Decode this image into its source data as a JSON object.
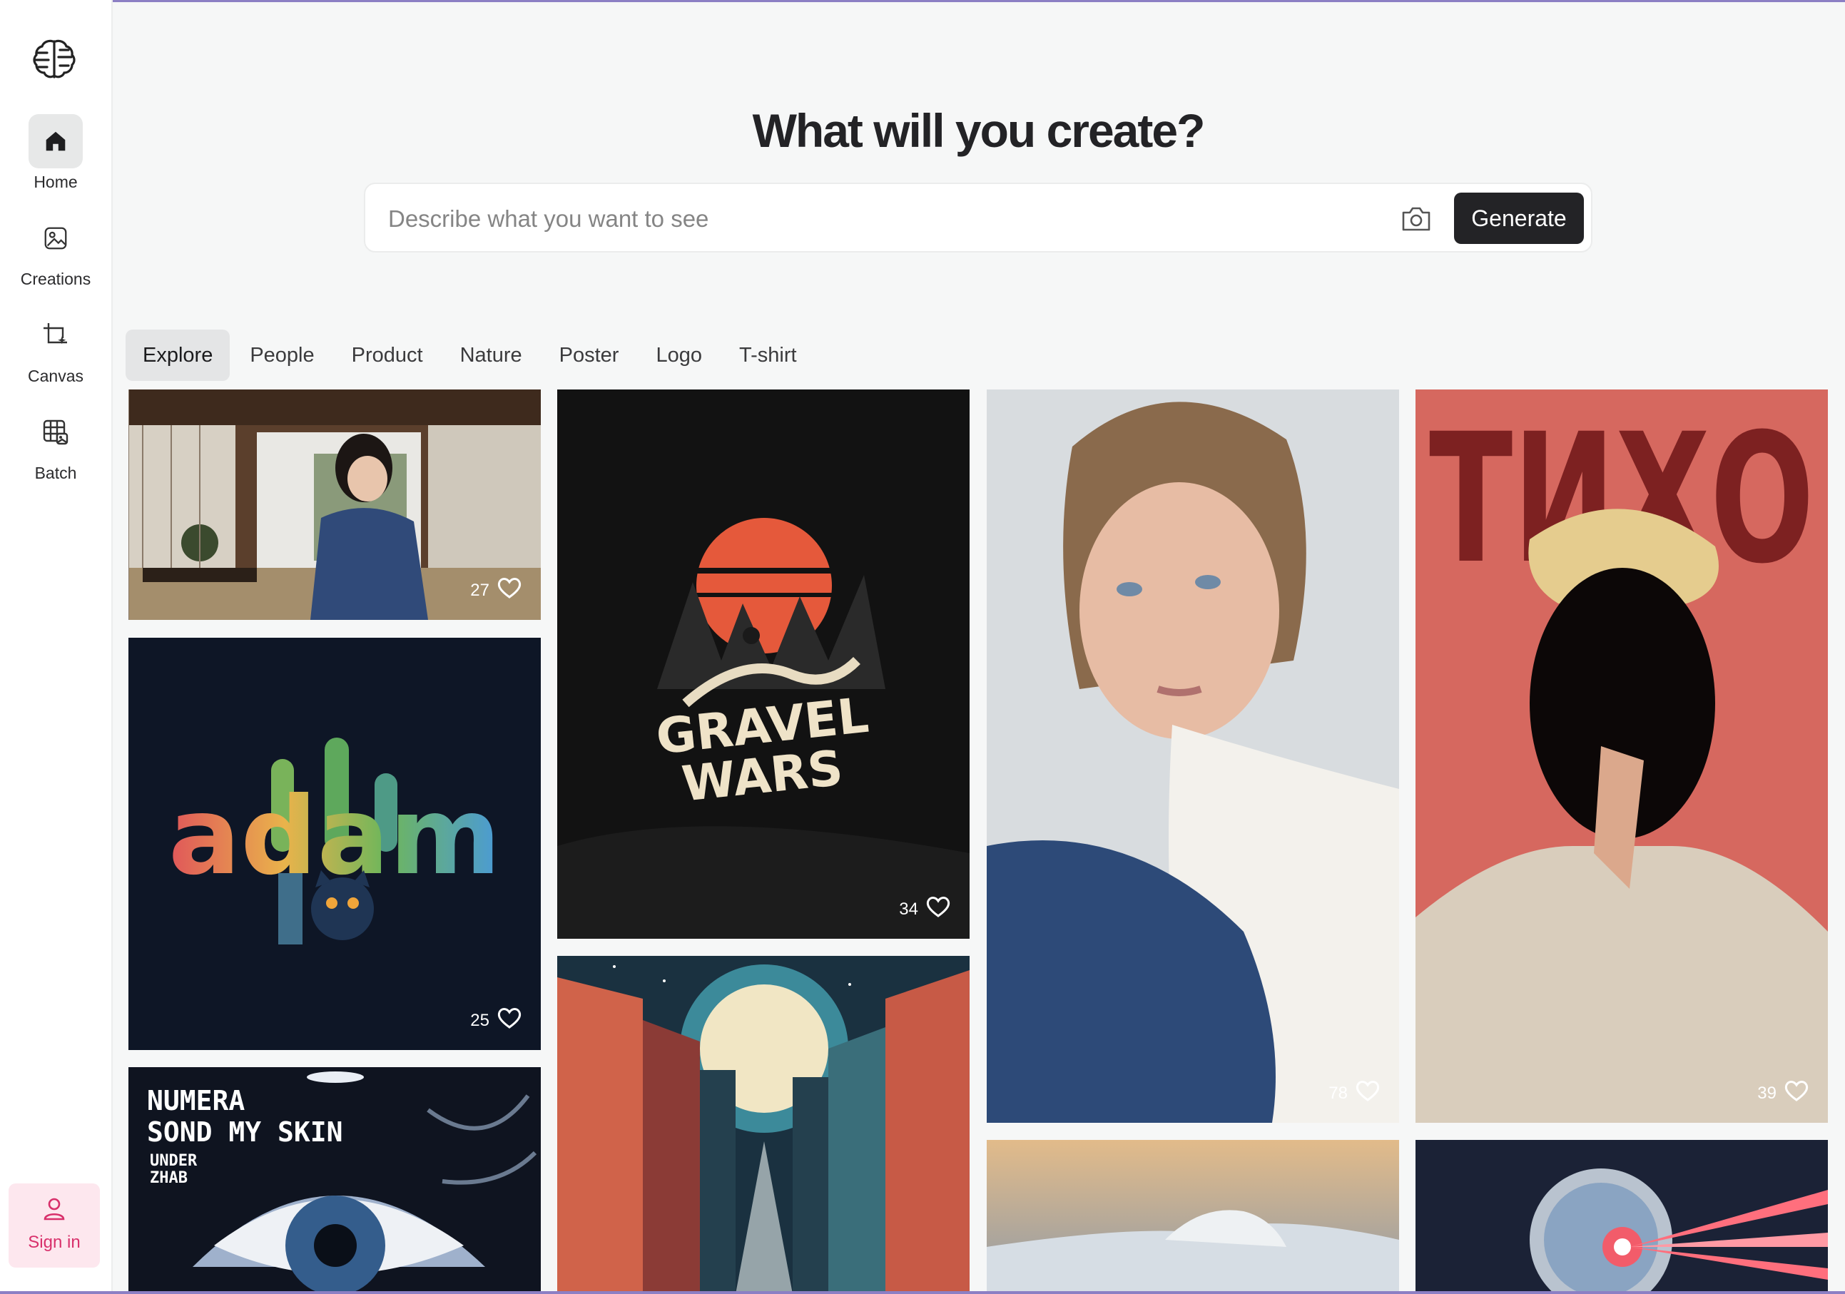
{
  "sidebar": {
    "logo_icon": "brain-icon",
    "items": [
      {
        "label": "Home",
        "icon": "home-icon",
        "active": true
      },
      {
        "label": "Creations",
        "icon": "image-icon",
        "active": false
      },
      {
        "label": "Canvas",
        "icon": "canvas-crop-icon",
        "active": false
      },
      {
        "label": "Batch",
        "icon": "batch-grid-icon",
        "active": false
      }
    ],
    "signin": {
      "label": "Sign in",
      "icon": "user-icon"
    }
  },
  "header": {
    "title": "What will you create?",
    "search_placeholder": "Describe what you want to see",
    "search_value": "",
    "camera_icon": "camera-icon",
    "generate_label": "Generate"
  },
  "tabs": [
    {
      "label": "Explore",
      "active": true
    },
    {
      "label": "People",
      "active": false
    },
    {
      "label": "Product",
      "active": false
    },
    {
      "label": "Nature",
      "active": false
    },
    {
      "label": "Poster",
      "active": false
    },
    {
      "label": "Logo",
      "active": false
    },
    {
      "label": "T-shirt",
      "active": false
    }
  ],
  "gallery": [
    {
      "likes": "27",
      "subject": "girl-in-japanese-room"
    },
    {
      "likes": "25",
      "text": "adam",
      "subject": "adam-cactus-cat-logo"
    },
    {
      "likes": "",
      "text_lines": [
        "NUMERA",
        "SOND MY SKIN",
        "UNDER",
        "ZHAB"
      ],
      "subject": "eye-poster"
    },
    {
      "likes": "34",
      "text_lines": [
        "GRAVEL",
        "WARS"
      ],
      "subject": "gravel-wars-poster"
    },
    {
      "likes": "",
      "subject": "city-moon-illustration"
    },
    {
      "likes": "78",
      "subject": "woman-portrait"
    },
    {
      "likes": "",
      "subject": "snowy-landscape"
    },
    {
      "likes": "39",
      "text": "ТИХО",
      "subject": "tikho-poster"
    },
    {
      "likes": "",
      "subject": "robot-laser"
    }
  ],
  "colors": {
    "accent_dark": "#232326",
    "signin_bg": "#fde7ee",
    "signin_text": "#d8306b"
  }
}
